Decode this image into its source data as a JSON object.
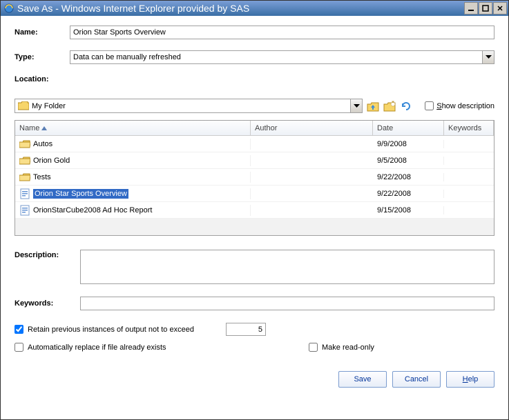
{
  "titlebar": {
    "title": "Save As - Windows Internet Explorer provided by SAS"
  },
  "fields": {
    "name_label": "Name:",
    "name_value": "Orion Star Sports Overview",
    "type_label": "Type:",
    "type_value": "Data can be manually refreshed",
    "location_label": "Location:",
    "location_value": "My Folder",
    "show_description": "how description"
  },
  "table": {
    "headers": {
      "name": "Name",
      "author": "Author",
      "date": "Date",
      "keywords": "Keywords"
    },
    "rows": [
      {
        "kind": "folder",
        "name": "Autos",
        "author": "",
        "date": "9/9/2008",
        "keywords": ""
      },
      {
        "kind": "folder",
        "name": "Orion Gold",
        "author": "",
        "date": "9/5/2008",
        "keywords": ""
      },
      {
        "kind": "folder",
        "name": "Tests",
        "author": "",
        "date": "9/22/2008",
        "keywords": ""
      },
      {
        "kind": "file",
        "name": "Orion Star Sports Overview",
        "author": "",
        "date": "9/22/2008",
        "keywords": "",
        "selected": true
      },
      {
        "kind": "file",
        "name": "OrionStarCube2008 Ad Hoc Report",
        "author": "",
        "date": "9/15/2008",
        "keywords": ""
      }
    ]
  },
  "description_label": "Description:",
  "description_value": "",
  "keywords_label": "Keywords:",
  "keywords_value": "",
  "options": {
    "retain_checked": true,
    "retain_label": "Retain previous instances of output not to exceed",
    "retain_value": "5",
    "replace_checked": false,
    "replace_label": "Automatically replace if file already exists",
    "readonly_checked": false,
    "readonly_label": "Make read-only"
  },
  "buttons": {
    "save": "Save",
    "cancel": "Cancel",
    "help": "elp"
  }
}
